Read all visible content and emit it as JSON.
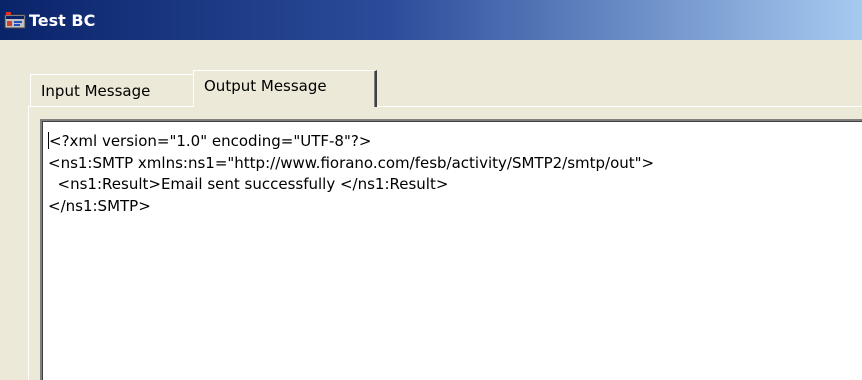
{
  "window": {
    "title": "Test BC",
    "icon": "app-window-icon"
  },
  "tabs": [
    {
      "label": "Input Message",
      "selected": false
    },
    {
      "label": "Output Message",
      "selected": true
    }
  ],
  "output": {
    "lines": [
      "<?xml version=\"1.0\" encoding=\"UTF-8\"?>",
      "<ns1:SMTP xmlns:ns1=\"http://www.fiorano.com/fesb/activity/SMTP2/smtp/out\">",
      "  <ns1:Result>Email sent successfully </ns1:Result>",
      "</ns1:SMTP>"
    ]
  },
  "colors": {
    "titlebar_start": "#0a246a",
    "titlebar_end": "#a6caf0",
    "window_background": "#ece9d8",
    "text_background": "#ffffff"
  }
}
